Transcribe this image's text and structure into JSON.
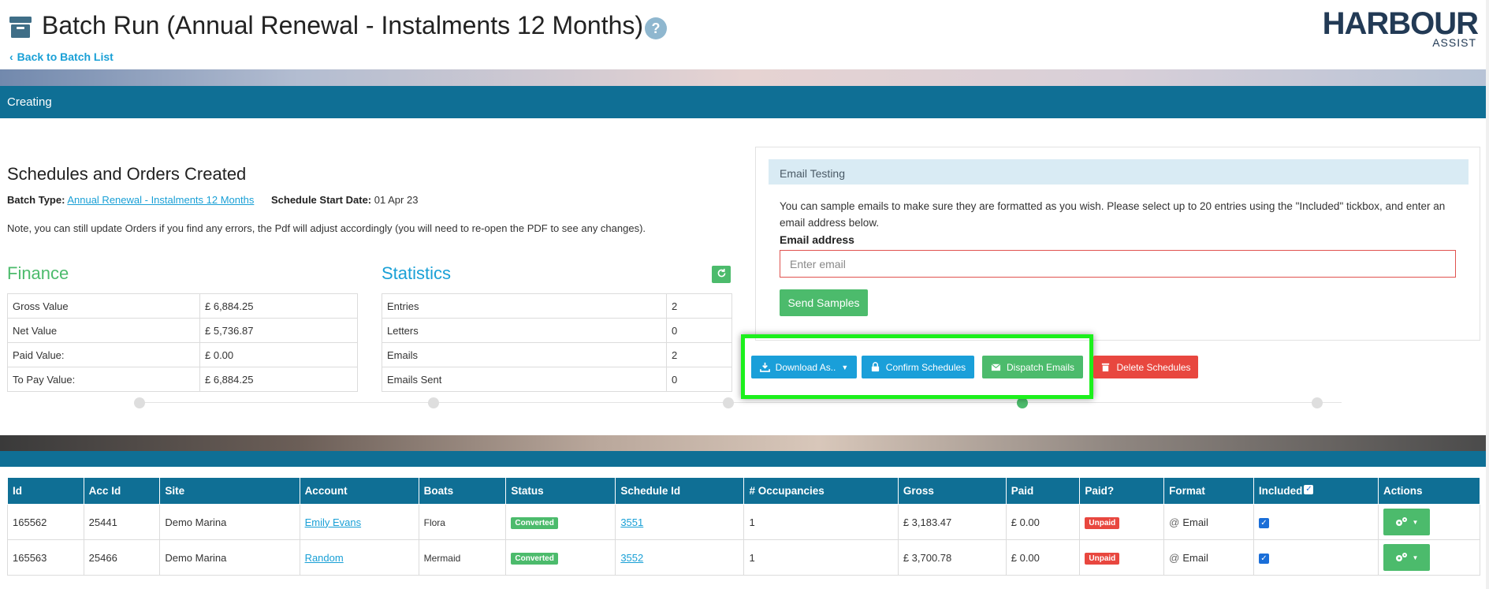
{
  "header": {
    "title": "Batch Run (Annual Renewal - Instalments 12 Months)",
    "help_label": "?",
    "back_label": "Back to Batch List",
    "back_chevron": "‹",
    "logo_main": "HARBOUR",
    "logo_sub": "ASSIST"
  },
  "status": {
    "text": "Creating"
  },
  "summary": {
    "title": "Schedules and Orders Created",
    "batch_type_label": "Batch Type:",
    "batch_type_value": "Annual Renewal - Instalments 12 Months",
    "start_date_label": "Schedule Start Date:",
    "start_date_value": "01 Apr 23",
    "note": "Note, you can still update Orders if you find any errors, the Pdf will adjust accordingly (you will need to re-open the PDF to see any changes)."
  },
  "finance": {
    "heading": "Finance",
    "rows": [
      {
        "label": "Gross Value",
        "value": "£ 6,884.25"
      },
      {
        "label": "Net Value",
        "value": "£ 5,736.87"
      },
      {
        "label": "Paid Value:",
        "value": "£ 0.00"
      },
      {
        "label": "To Pay Value:",
        "value": "£ 6,884.25"
      }
    ]
  },
  "statistics": {
    "heading": "Statistics",
    "refresh_icon": "refresh-icon",
    "rows": [
      {
        "label": "Entries",
        "value": "2"
      },
      {
        "label": "Letters",
        "value": "0"
      },
      {
        "label": "Emails",
        "value": "2"
      },
      {
        "label": "Emails Sent",
        "value": "0"
      }
    ]
  },
  "email_testing": {
    "heading": "Email Testing",
    "description": "You can sample emails to make sure they are formatted as you wish. Please select up to 20 entries using the \"Included\" tickbox, and enter an email address below.",
    "label": "Email address",
    "placeholder": "Enter email",
    "send_label": "Send Samples"
  },
  "actions": {
    "download_label": "Download As..",
    "confirm_label": "Confirm Schedules",
    "dispatch_label": "Dispatch Emails",
    "delete_label": "Delete Schedules"
  },
  "progress": {
    "active_step": 4,
    "total_steps": 5
  },
  "table": {
    "columns": [
      "Id",
      "Acc Id",
      "Site",
      "Account",
      "Boats",
      "Status",
      "Schedule Id",
      "# Occupancies",
      "Gross",
      "Paid",
      "Paid?",
      "Format",
      "Included",
      "Actions"
    ],
    "rows": [
      {
        "id": "165562",
        "acc_id": "25441",
        "site": "Demo Marina",
        "account": "Emily Evans",
        "boats": "Flora",
        "status": "Converted",
        "schedule_id": "3551",
        "occupancies": "1",
        "gross": "£ 3,183.47",
        "paid": "£ 0.00",
        "paid_status": "Unpaid",
        "format_icon": "@",
        "format": "Email",
        "included": true
      },
      {
        "id": "165563",
        "acc_id": "25466",
        "site": "Demo Marina",
        "account": "Random",
        "boats": "Mermaid",
        "status": "Converted",
        "schedule_id": "3552",
        "occupancies": "1",
        "gross": "£ 3,700.78",
        "paid": "£ 0.00",
        "paid_status": "Unpaid",
        "format_icon": "@",
        "format": "Email",
        "included": true
      }
    ]
  },
  "colors": {
    "teal": "#0f6f95",
    "green": "#4cbb6c",
    "blue": "#1a9fd9",
    "red": "#e8473f",
    "highlight": "#1cf01c"
  }
}
